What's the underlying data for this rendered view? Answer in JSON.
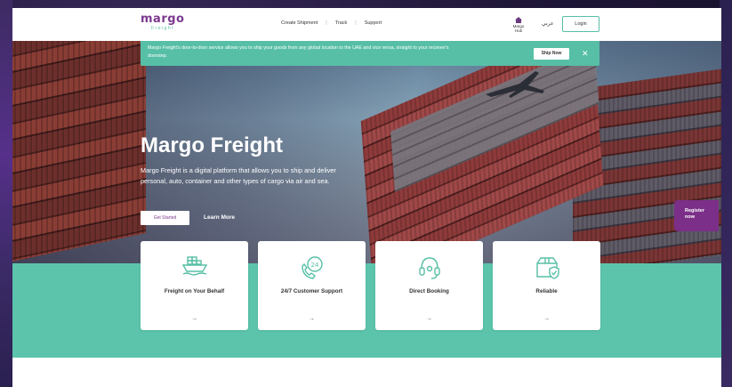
{
  "brand": {
    "logo_main": "margo",
    "logo_sub": "Freight",
    "accent": "#57bfa6",
    "purple": "#7b3a8f"
  },
  "nav": {
    "links": [
      "Create Shipment",
      "Track",
      "Support"
    ],
    "hub_label": "Margo Hub",
    "hub_icon": "home-icon",
    "language": "عربي",
    "login_label": "Login"
  },
  "banner": {
    "text": "Margo Freight's door-to-door service allows you to ship your goods from any global location to the UAE and vice versa, straight to your reciever's doorstep.",
    "ship_now_label": "Ship Now",
    "close_icon": "close-icon"
  },
  "hero": {
    "title": "Margo Freight",
    "description": "Margo Freight is a digital platform that allows you to ship and deliver personal, auto, container and other types of cargo via air and sea.",
    "primary_button": "Get Started",
    "secondary_button": "Learn More"
  },
  "features": [
    {
      "title": "Freight on Your Behalf",
      "icon": "cargo-ship-icon",
      "arrow": "→"
    },
    {
      "title": "24/7 Customer Support",
      "icon": "support-24-icon",
      "arrow": "→"
    },
    {
      "title": "Direct Booking",
      "icon": "headset-icon",
      "arrow": "→"
    },
    {
      "title": "Reliable",
      "icon": "shield-box-icon",
      "arrow": "→"
    }
  ],
  "register": {
    "label_line1": "Register",
    "label_line2": "now"
  }
}
